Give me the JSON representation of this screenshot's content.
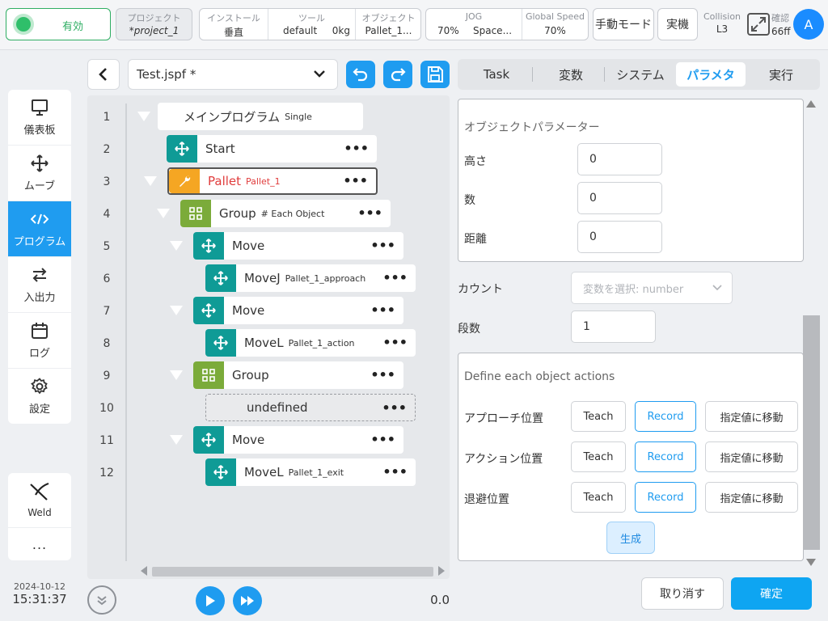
{
  "topbar": {
    "status": "有効",
    "project": {
      "label": "プロジェクト",
      "value": "*project_1"
    },
    "install": {
      "label": "インストール",
      "value": "垂直"
    },
    "tool": {
      "label": "ツール",
      "value": "default",
      "weight": "0kg"
    },
    "object": {
      "label": "オブジェクト",
      "value": "Pallet_1..."
    },
    "jog": {
      "label": "JOG",
      "value": "70%",
      "space": "Space..."
    },
    "global_speed": {
      "label": "Global Speed",
      "value": "70%"
    },
    "mode_button": "手動モード",
    "real_button": "実機",
    "collision": {
      "label": "Collision",
      "value": "L3"
    },
    "confirm": {
      "label": "確認",
      "value": "66ff"
    },
    "avatar": "A"
  },
  "nav": {
    "items": [
      {
        "label": "儀表板",
        "icon": "monitor-icon"
      },
      {
        "label": "ムーブ",
        "icon": "move-icon"
      },
      {
        "label": "プログラム",
        "icon": "code-icon",
        "active": true
      },
      {
        "label": "入出力",
        "icon": "io-icon"
      },
      {
        "label": "ログ",
        "icon": "calendar-icon"
      },
      {
        "label": "設定",
        "icon": "gear-icon"
      }
    ],
    "weld": "Weld",
    "more": "..."
  },
  "clock": {
    "date": "2024-10-12",
    "time": "15:31:37"
  },
  "editor": {
    "file": "Test.jspf *",
    "lines": [
      "1",
      "2",
      "3",
      "4",
      "5",
      "6",
      "7",
      "8",
      "9",
      "10",
      "11",
      "12"
    ],
    "nodes": [
      {
        "label": "メインプログラム",
        "sub": "Single"
      },
      {
        "label": "Start",
        "sub": ""
      },
      {
        "label": "Pallet",
        "sub": "Pallet_1"
      },
      {
        "label": "Group",
        "sub": "# Each Object"
      },
      {
        "label": "Move",
        "sub": ""
      },
      {
        "label": "MoveJ",
        "sub": "Pallet_1_approach"
      },
      {
        "label": "Move",
        "sub": ""
      },
      {
        "label": "MoveL",
        "sub": "Pallet_1_action"
      },
      {
        "label": "Group",
        "sub": ""
      },
      {
        "label": "undefined",
        "sub": ""
      },
      {
        "label": "Move",
        "sub": ""
      },
      {
        "label": "MoveL",
        "sub": "Pallet_1_exit"
      }
    ],
    "dots": "•••",
    "speed": "0.0"
  },
  "tabs": [
    "Task",
    "変数",
    "システム",
    "パラメタ",
    "実行"
  ],
  "params": {
    "object_title": "オブジェクトパラメーター",
    "height": {
      "label": "高さ",
      "value": "0"
    },
    "count_num": {
      "label": "数",
      "value": "0"
    },
    "distance": {
      "label": "距離",
      "value": "0"
    },
    "count": {
      "label": "カウント",
      "placeholder": "変数を選択: number"
    },
    "stages": {
      "label": "段数",
      "value": "1"
    },
    "actions_title": "Define each object actions",
    "rows": [
      {
        "label": "アプローチ位置"
      },
      {
        "label": "アクション位置"
      },
      {
        "label": "退避位置"
      }
    ],
    "teach": "Teach",
    "record": "Record",
    "move_to": "指定値に移動",
    "generate": "生成"
  },
  "footer": {
    "cancel": "取り消す",
    "ok": "確定"
  }
}
